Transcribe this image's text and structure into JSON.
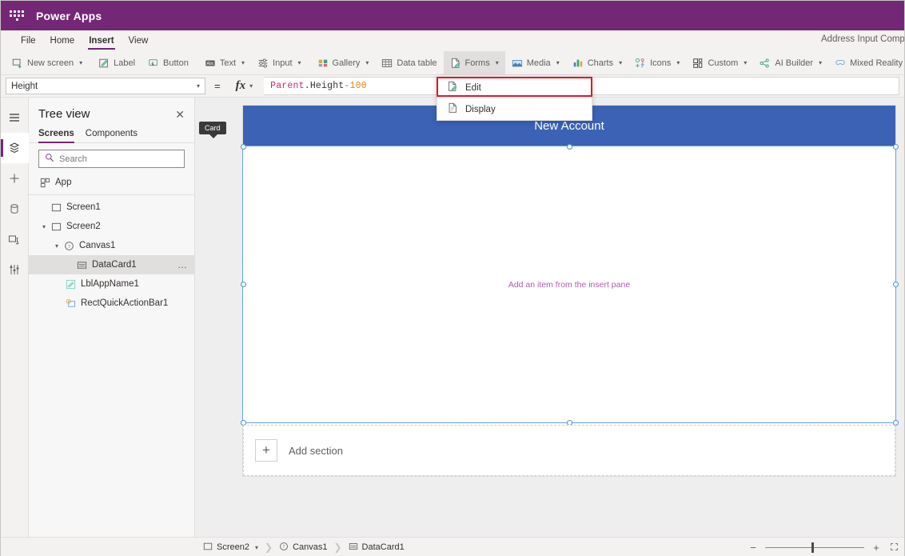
{
  "suite": {
    "title": "Power Apps",
    "waffle_icon": "waffle-grid-icon"
  },
  "menubar": {
    "items": [
      {
        "label": "File",
        "active": false
      },
      {
        "label": "Home",
        "active": false
      },
      {
        "label": "Insert",
        "active": true
      },
      {
        "label": "View",
        "active": false
      }
    ],
    "app_name": "Address Input Comp"
  },
  "ribbon": {
    "items": [
      {
        "label": "New screen",
        "icon": "new-screen-icon",
        "chevron": true,
        "selected": false
      },
      {
        "label": "Label",
        "icon": "label-icon",
        "chevron": false,
        "selected": false
      },
      {
        "label": "Button",
        "icon": "button-icon",
        "chevron": false,
        "selected": false
      },
      {
        "label": "Text",
        "icon": "text-icon",
        "chevron": true,
        "selected": false
      },
      {
        "label": "Input",
        "icon": "input-icon",
        "chevron": true,
        "selected": false
      },
      {
        "label": "Gallery",
        "icon": "gallery-icon",
        "chevron": true,
        "selected": false
      },
      {
        "label": "Data table",
        "icon": "data-table-icon",
        "chevron": false,
        "selected": false
      },
      {
        "label": "Forms",
        "icon": "forms-icon",
        "chevron": true,
        "selected": true
      },
      {
        "label": "Media",
        "icon": "media-icon",
        "chevron": true,
        "selected": false
      },
      {
        "label": "Charts",
        "icon": "charts-icon",
        "chevron": true,
        "selected": false
      },
      {
        "label": "Icons",
        "icon": "icons-icon",
        "chevron": true,
        "selected": false
      },
      {
        "label": "Custom",
        "icon": "custom-icon",
        "chevron": true,
        "selected": false
      },
      {
        "label": "AI Builder",
        "icon": "ai-builder-icon",
        "chevron": true,
        "selected": false
      },
      {
        "label": "Mixed Reality",
        "icon": "mixed-reality-icon",
        "chevron": true,
        "selected": false
      }
    ]
  },
  "forms_menu": {
    "items": [
      {
        "label": "Edit",
        "icon": "edit-form-icon",
        "highlighted": true
      },
      {
        "label": "Display",
        "icon": "display-form-icon",
        "highlighted": false
      }
    ]
  },
  "formula_bar": {
    "property": "Height",
    "equals": "=",
    "fx_label": "fx",
    "formula_tokens": [
      {
        "text": "Parent",
        "type": "parent"
      },
      {
        "text": ".Height",
        "type": "prop"
      },
      {
        "text": " - ",
        "type": "op"
      },
      {
        "text": "100",
        "type": "num"
      }
    ]
  },
  "rail": {
    "items": [
      {
        "icon": "hamburger-menu-icon",
        "active": false
      },
      {
        "icon": "tree-view-icon",
        "active": true
      },
      {
        "icon": "insert-plus-icon",
        "active": false
      },
      {
        "icon": "data-cylinder-icon",
        "active": false
      },
      {
        "icon": "media-library-icon",
        "active": false
      },
      {
        "icon": "advanced-settings-icon",
        "active": false
      }
    ]
  },
  "tree_view": {
    "title": "Tree view",
    "close_icon": "close-icon",
    "tabs": [
      {
        "label": "Screens",
        "active": true
      },
      {
        "label": "Components",
        "active": false
      }
    ],
    "search_placeholder": "Search",
    "search_value": "",
    "search_icon": "search-icon",
    "nodes": [
      {
        "label": "App",
        "icon": "app-icon",
        "indent": 0,
        "expander": "",
        "selected": false,
        "dots": false
      },
      {
        "label": "Screen1",
        "icon": "screen-icon",
        "indent": 0,
        "expander": "",
        "selected": false,
        "dots": false
      },
      {
        "label": "Screen2",
        "icon": "screen-icon",
        "indent": 0,
        "expander": "v",
        "selected": false,
        "dots": false
      },
      {
        "label": "Canvas1",
        "icon": "canvas-icon",
        "indent": 1,
        "expander": "v",
        "selected": false,
        "dots": false
      },
      {
        "label": "DataCard1",
        "icon": "datacard-icon",
        "indent": 2,
        "expander": "",
        "selected": true,
        "dots": true
      },
      {
        "label": "LblAppName1",
        "icon": "label-icon",
        "indent": 1,
        "expander": "",
        "selected": false,
        "dots": false
      },
      {
        "label": "RectQuickActionBar1",
        "icon": "rectangle-icon",
        "indent": 1,
        "expander": "",
        "selected": false,
        "dots": false
      }
    ]
  },
  "canvas": {
    "screen_title": "New Account",
    "header_color": "#3b62b5",
    "card_badge": "Card",
    "placeholder_text": "Add an item from the insert pane",
    "placeholder_color": "#b05ca8",
    "add_section_label": "Add section",
    "add_section_icon": "plus-icon",
    "selection_color": "#4a90d9"
  },
  "status_bar": {
    "breadcrumbs": [
      {
        "label": "Screen2",
        "icon": "screen-icon",
        "chevron": true
      },
      {
        "label": "Canvas1",
        "icon": "canvas-icon",
        "chevron": false
      },
      {
        "label": "DataCard1",
        "icon": "datacard-icon",
        "chevron": false
      }
    ],
    "zoom_minus": "−",
    "zoom_plus": "+",
    "fit_icon": "fit-to-screen-icon"
  }
}
